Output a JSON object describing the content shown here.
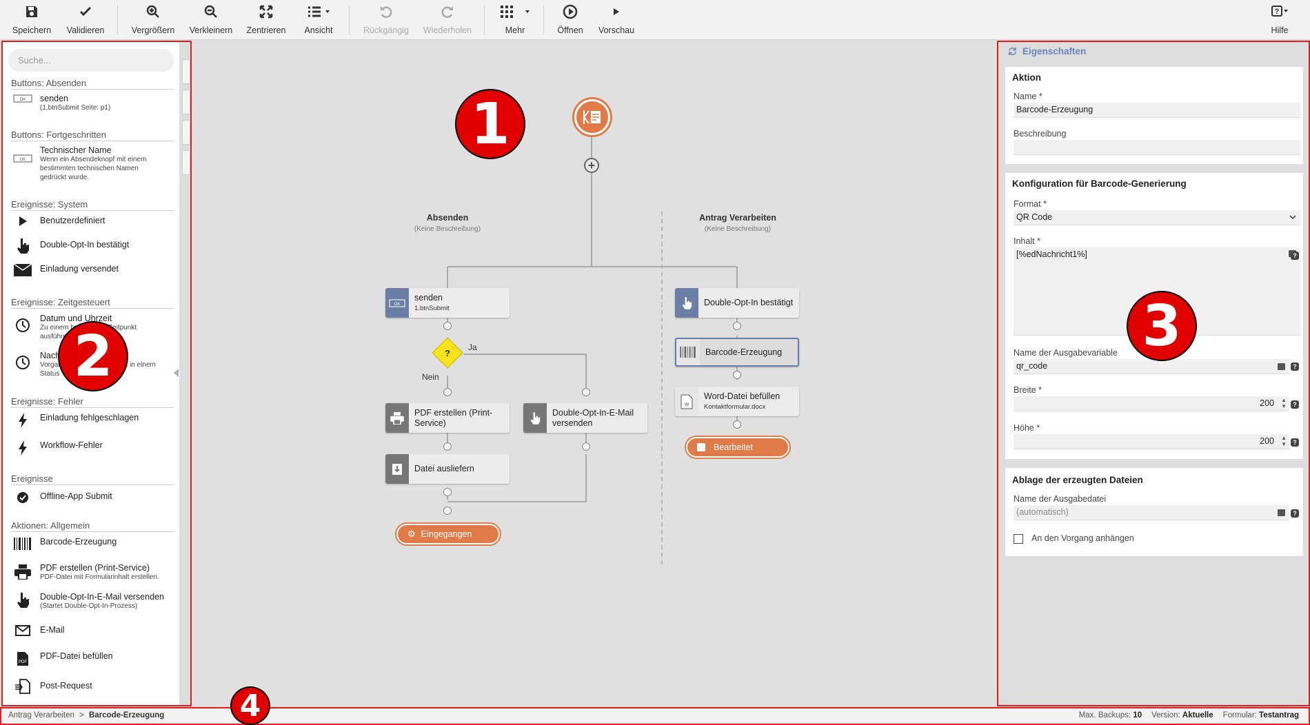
{
  "toolbar": {
    "save": "Speichern",
    "validate": "Validieren",
    "zoom_in": "Vergrößern",
    "zoom_out": "Verkleinern",
    "center": "Zentrieren",
    "view": "Ansicht",
    "undo": "Rückgängig",
    "redo": "Wiederholen",
    "more": "Mehr",
    "open": "Öffnen",
    "preview": "Vorschau",
    "help": "Hilfe"
  },
  "sidebar": {
    "search_placeholder": "Suche...",
    "sections": {
      "s1": "Buttons: Absenden",
      "s2": "Buttons: Fortgeschritten",
      "s3": "Ereignisse: System",
      "s4": "Ereignisse: Zeitgesteuert",
      "s5": "Ereignisse: Fehler",
      "s6": "Ereignisse",
      "s7": "Aktionen: Allgemein"
    },
    "items": {
      "senden": {
        "t1": "senden",
        "t2": "(1.btnSubmit Seite: p1)"
      },
      "technischer": {
        "t1": "Technischer Name",
        "t2": "Wenn ein Absendeknopf mit einem bestimmten technischen Namen gedrückt wurde."
      },
      "benutzer": {
        "t1": "Benutzerdefiniert"
      },
      "doi": {
        "t1": "Double-Opt-In bestätigt"
      },
      "einladung": {
        "t1": "Einladung versendet"
      },
      "datum": {
        "t1": "Datum und Uhrzeit",
        "t2": "Zu einem bestimmten Zeitpunkt ausführen"
      },
      "nach": {
        "t1": "Nach",
        "t2": "Vorgang eine bestimmte Zeit in einem Status"
      },
      "fehl": {
        "t1": "Einladung fehlgeschlagen"
      },
      "wffehler": {
        "t1": "Workflow-Fehler"
      },
      "offline": {
        "t1": "Offline-App Submit"
      },
      "barcode": {
        "t1": "Barcode-Erzeugung"
      },
      "pdf": {
        "t1": "PDF erstellen (Print-Service)",
        "t2": "PDF-Datei mit Formularinhalt erstellen."
      },
      "doimail": {
        "t1": "Double-Opt-In-E-Mail versenden",
        "t2": "(Startet Double-Opt-In-Prozess)"
      },
      "email": {
        "t1": "E-Mail"
      },
      "pdffill": {
        "t1": "PDF-Datei befüllen"
      },
      "post": {
        "t1": "Post-Request"
      }
    }
  },
  "canvas": {
    "branch1_title": "Absenden",
    "branch1_desc": "(Keine Beschreibung)",
    "branch2_title": "Antrag Verarbeiten",
    "branch2_desc": "(Keine Beschreibung)",
    "n_senden": "senden",
    "n_senden_sub": "1.btnSubmit",
    "decision": "?",
    "ja": "Ja",
    "nein": "Nein",
    "n_pdf": "PDF erstellen (Print-Service)",
    "n_doimail": "Double-Opt-In-E-Mail versenden",
    "n_datei": "Datei ausliefern",
    "end1": "Eingegangen",
    "n_doi": "Double-Opt-In bestätigt",
    "n_barcode": "Barcode-Erzeugung",
    "n_word": "Word-Datei befüllen",
    "n_word_sub": "Kontaktformular.docx",
    "end2": "Bearbeitet"
  },
  "properties": {
    "header": "Eigenschaften",
    "p1_title": "Aktion",
    "name_label": "Name *",
    "name_value": "Barcode-Erzeugung",
    "desc_label": "Beschreibung",
    "p2_title": "Konfiguration für Barcode-Generierung",
    "format_label": "Format *",
    "format_value": "QR Code",
    "content_label": "Inhalt *",
    "content_value": "[%edNachricht1%]",
    "outvar_label": "Name der Ausgabevariable",
    "outvar_value": "qr_code",
    "width_label": "Breite *",
    "width_value": "200",
    "height_label": "Höhe *",
    "height_value": "200",
    "p3_title": "Ablage der erzeugten Dateien",
    "outfile_label": "Name der Ausgabedatei",
    "outfile_placeholder": "(automatisch)",
    "attach_label": "An den Vorgang anhängen"
  },
  "statusbar": {
    "crumb1": "Antrag Verarbeiten",
    "sep": ">",
    "crumb2": "Barcode-Erzeugung",
    "backups_label": "Max. Backups:",
    "backups_value": "10",
    "version_label": "Version:",
    "version_value": "Aktuelle",
    "form_label": "Formular:",
    "form_value": "Testantrag"
  },
  "annotations": {
    "b1": "1",
    "b2": "2",
    "b3": "3",
    "b4": "4"
  },
  "colors": {
    "accent_orange": "#e07a46",
    "node_blue": "#6b7fa6",
    "node_gray": "#777777",
    "highlight_red": "#e51c1c"
  }
}
